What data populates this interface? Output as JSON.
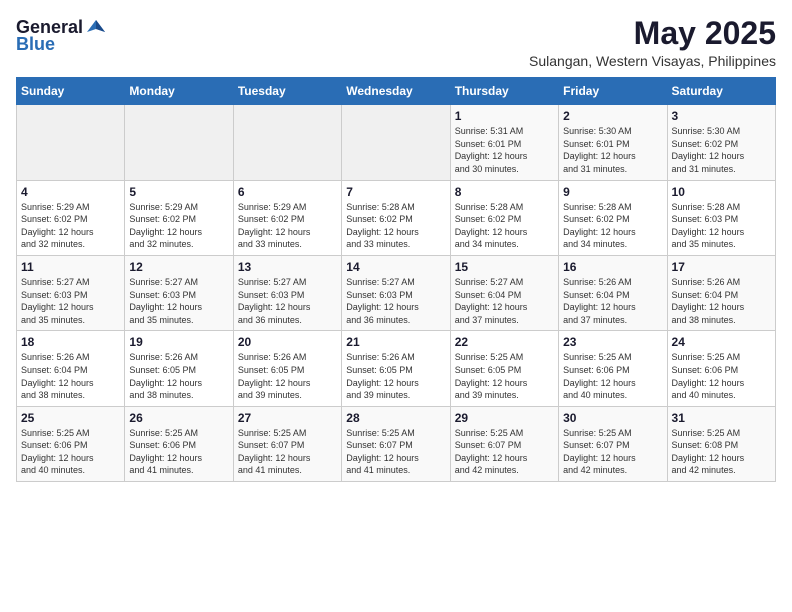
{
  "logo": {
    "general": "General",
    "blue": "Blue"
  },
  "title": "May 2025",
  "location": "Sulangan, Western Visayas, Philippines",
  "weekdays": [
    "Sunday",
    "Monday",
    "Tuesday",
    "Wednesday",
    "Thursday",
    "Friday",
    "Saturday"
  ],
  "weeks": [
    [
      {
        "day": "",
        "info": ""
      },
      {
        "day": "",
        "info": ""
      },
      {
        "day": "",
        "info": ""
      },
      {
        "day": "",
        "info": ""
      },
      {
        "day": "1",
        "info": "Sunrise: 5:31 AM\nSunset: 6:01 PM\nDaylight: 12 hours\nand 30 minutes."
      },
      {
        "day": "2",
        "info": "Sunrise: 5:30 AM\nSunset: 6:01 PM\nDaylight: 12 hours\nand 31 minutes."
      },
      {
        "day": "3",
        "info": "Sunrise: 5:30 AM\nSunset: 6:02 PM\nDaylight: 12 hours\nand 31 minutes."
      }
    ],
    [
      {
        "day": "4",
        "info": "Sunrise: 5:29 AM\nSunset: 6:02 PM\nDaylight: 12 hours\nand 32 minutes."
      },
      {
        "day": "5",
        "info": "Sunrise: 5:29 AM\nSunset: 6:02 PM\nDaylight: 12 hours\nand 32 minutes."
      },
      {
        "day": "6",
        "info": "Sunrise: 5:29 AM\nSunset: 6:02 PM\nDaylight: 12 hours\nand 33 minutes."
      },
      {
        "day": "7",
        "info": "Sunrise: 5:28 AM\nSunset: 6:02 PM\nDaylight: 12 hours\nand 33 minutes."
      },
      {
        "day": "8",
        "info": "Sunrise: 5:28 AM\nSunset: 6:02 PM\nDaylight: 12 hours\nand 34 minutes."
      },
      {
        "day": "9",
        "info": "Sunrise: 5:28 AM\nSunset: 6:02 PM\nDaylight: 12 hours\nand 34 minutes."
      },
      {
        "day": "10",
        "info": "Sunrise: 5:28 AM\nSunset: 6:03 PM\nDaylight: 12 hours\nand 35 minutes."
      }
    ],
    [
      {
        "day": "11",
        "info": "Sunrise: 5:27 AM\nSunset: 6:03 PM\nDaylight: 12 hours\nand 35 minutes."
      },
      {
        "day": "12",
        "info": "Sunrise: 5:27 AM\nSunset: 6:03 PM\nDaylight: 12 hours\nand 35 minutes."
      },
      {
        "day": "13",
        "info": "Sunrise: 5:27 AM\nSunset: 6:03 PM\nDaylight: 12 hours\nand 36 minutes."
      },
      {
        "day": "14",
        "info": "Sunrise: 5:27 AM\nSunset: 6:03 PM\nDaylight: 12 hours\nand 36 minutes."
      },
      {
        "day": "15",
        "info": "Sunrise: 5:27 AM\nSunset: 6:04 PM\nDaylight: 12 hours\nand 37 minutes."
      },
      {
        "day": "16",
        "info": "Sunrise: 5:26 AM\nSunset: 6:04 PM\nDaylight: 12 hours\nand 37 minutes."
      },
      {
        "day": "17",
        "info": "Sunrise: 5:26 AM\nSunset: 6:04 PM\nDaylight: 12 hours\nand 38 minutes."
      }
    ],
    [
      {
        "day": "18",
        "info": "Sunrise: 5:26 AM\nSunset: 6:04 PM\nDaylight: 12 hours\nand 38 minutes."
      },
      {
        "day": "19",
        "info": "Sunrise: 5:26 AM\nSunset: 6:05 PM\nDaylight: 12 hours\nand 38 minutes."
      },
      {
        "day": "20",
        "info": "Sunrise: 5:26 AM\nSunset: 6:05 PM\nDaylight: 12 hours\nand 39 minutes."
      },
      {
        "day": "21",
        "info": "Sunrise: 5:26 AM\nSunset: 6:05 PM\nDaylight: 12 hours\nand 39 minutes."
      },
      {
        "day": "22",
        "info": "Sunrise: 5:25 AM\nSunset: 6:05 PM\nDaylight: 12 hours\nand 39 minutes."
      },
      {
        "day": "23",
        "info": "Sunrise: 5:25 AM\nSunset: 6:06 PM\nDaylight: 12 hours\nand 40 minutes."
      },
      {
        "day": "24",
        "info": "Sunrise: 5:25 AM\nSunset: 6:06 PM\nDaylight: 12 hours\nand 40 minutes."
      }
    ],
    [
      {
        "day": "25",
        "info": "Sunrise: 5:25 AM\nSunset: 6:06 PM\nDaylight: 12 hours\nand 40 minutes."
      },
      {
        "day": "26",
        "info": "Sunrise: 5:25 AM\nSunset: 6:06 PM\nDaylight: 12 hours\nand 41 minutes."
      },
      {
        "day": "27",
        "info": "Sunrise: 5:25 AM\nSunset: 6:07 PM\nDaylight: 12 hours\nand 41 minutes."
      },
      {
        "day": "28",
        "info": "Sunrise: 5:25 AM\nSunset: 6:07 PM\nDaylight: 12 hours\nand 41 minutes."
      },
      {
        "day": "29",
        "info": "Sunrise: 5:25 AM\nSunset: 6:07 PM\nDaylight: 12 hours\nand 42 minutes."
      },
      {
        "day": "30",
        "info": "Sunrise: 5:25 AM\nSunset: 6:07 PM\nDaylight: 12 hours\nand 42 minutes."
      },
      {
        "day": "31",
        "info": "Sunrise: 5:25 AM\nSunset: 6:08 PM\nDaylight: 12 hours\nand 42 minutes."
      }
    ]
  ]
}
